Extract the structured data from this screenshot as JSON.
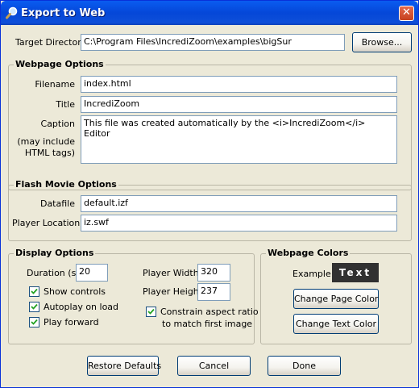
{
  "window": {
    "title": "Export to Web",
    "close_symbol": "✕"
  },
  "target": {
    "label": "Target Directory",
    "value": "C:\\Program Files\\IncrediZoom\\examples\\bigSur",
    "browse_label": "Browse..."
  },
  "webpage_options": {
    "title": "Webpage Options",
    "filename_label": "Filename",
    "filename_value": "index.html",
    "title_label": "Title",
    "title_value": "IncrediZoom",
    "caption_label": "Caption",
    "caption_note_1": "(may include",
    "caption_note_2": "HTML tags)",
    "caption_value": "This file was created automatically by the <i>IncrediZoom</i> Editor"
  },
  "flash_options": {
    "title": "Flash Movie Options",
    "datafile_label": "Datafile",
    "datafile_value": "default.izf",
    "player_location_label": "Player Location",
    "player_location_value": "iz.swf"
  },
  "display_options": {
    "title": "Display Options",
    "duration_label": "Duration (s)",
    "duration_value": "20",
    "player_width_label": "Player Width",
    "player_width_value": "320",
    "player_height_label": "Player Height",
    "player_height_value": "237",
    "show_controls_label": "Show controls",
    "show_controls_checked": true,
    "autoplay_label": "Autoplay on load",
    "autoplay_checked": true,
    "play_forward_label": "Play forward",
    "play_forward_checked": true,
    "constrain_label_1": "Constrain aspect ratio",
    "constrain_label_2": "to match first image",
    "constrain_checked": true
  },
  "webpage_colors": {
    "title": "Webpage Colors",
    "example_label": "Example:",
    "example_text": "Text",
    "page_color": "#313131",
    "text_color": "#ffffff",
    "change_page_color_label": "Change Page Color",
    "change_text_color_label": "Change Text Color"
  },
  "footer": {
    "restore_label": "Restore Defaults",
    "cancel_label": "Cancel",
    "done_label": "Done"
  }
}
